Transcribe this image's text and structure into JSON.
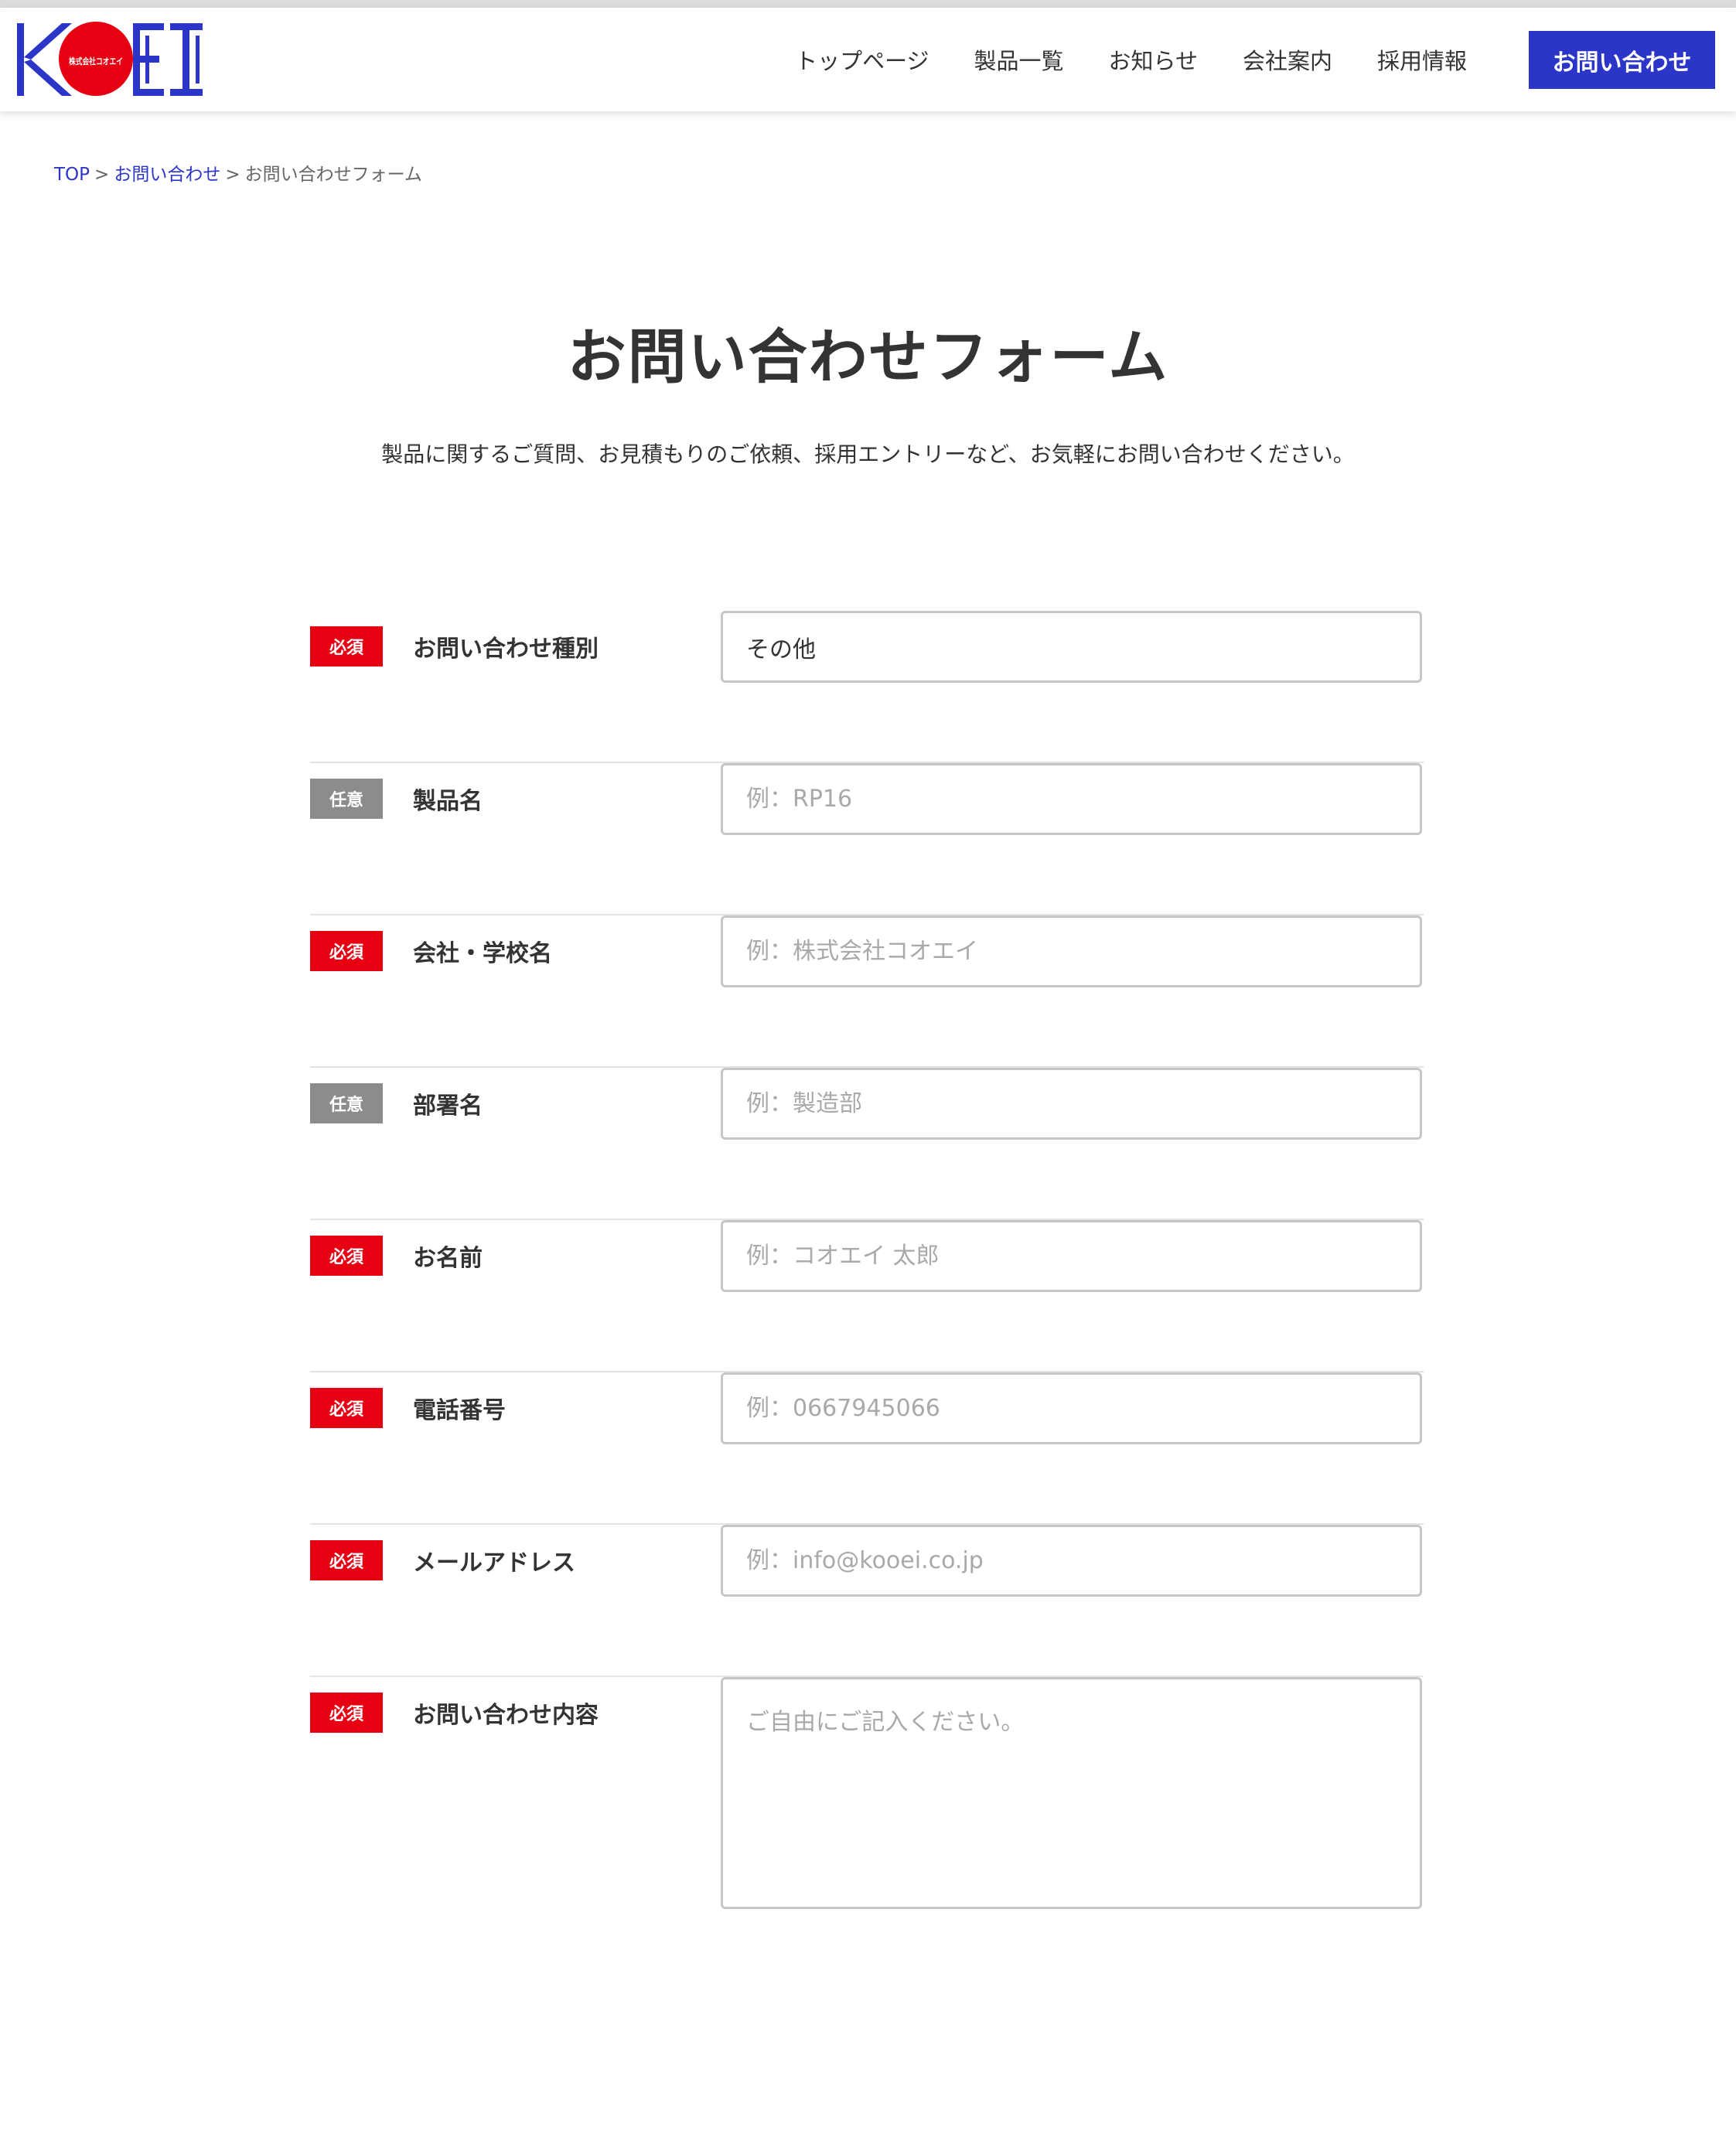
{
  "header": {
    "logo_text": "KOEI",
    "logo_sub": "株式会社コオエイ",
    "nav": [
      "トップページ",
      "製品一覧",
      "お知らせ",
      "会社案内",
      "採用情報"
    ],
    "cta_label": "お問い合わせ"
  },
  "breadcrumb": {
    "items": [
      "TOP",
      "お問い合わせ",
      "お問い合わせフォーム"
    ],
    "separator": ">"
  },
  "page": {
    "title": "お問い合わせフォーム",
    "lead": "製品に関するご質問、お見積もりのご依頼、採用エントリーなど、お気軽にお問い合わせください。"
  },
  "form": {
    "badges": {
      "required": "必須",
      "optional": "任意"
    },
    "fields": [
      {
        "label": "お問い合わせ種別",
        "badge": "必須",
        "value": "その他"
      },
      {
        "label": "製品名",
        "badge": "任意",
        "placeholder": "例：RP16"
      },
      {
        "label": "会社・学校名",
        "badge": "必須",
        "placeholder": "例：株式会社コオエイ"
      },
      {
        "label": "部署名",
        "badge": "任意",
        "placeholder": "例：製造部"
      },
      {
        "label": "お名前",
        "badge": "必須",
        "placeholder": "例：コオエイ 太郎"
      },
      {
        "label": "電話番号",
        "badge": "必須",
        "placeholder": "例：0667945066"
      },
      {
        "label": "メールアドレス",
        "badge": "必須",
        "placeholder": "例：info@kooei.co.jp"
      },
      {
        "label": "お問い合わせ内容",
        "badge": "必須",
        "placeholder": "ご自由にご記入ください。"
      }
    ]
  },
  "colors": {
    "brand_blue": "#2b35c8",
    "brand_red": "#e60012",
    "optional_gray": "#8c8c8c"
  }
}
